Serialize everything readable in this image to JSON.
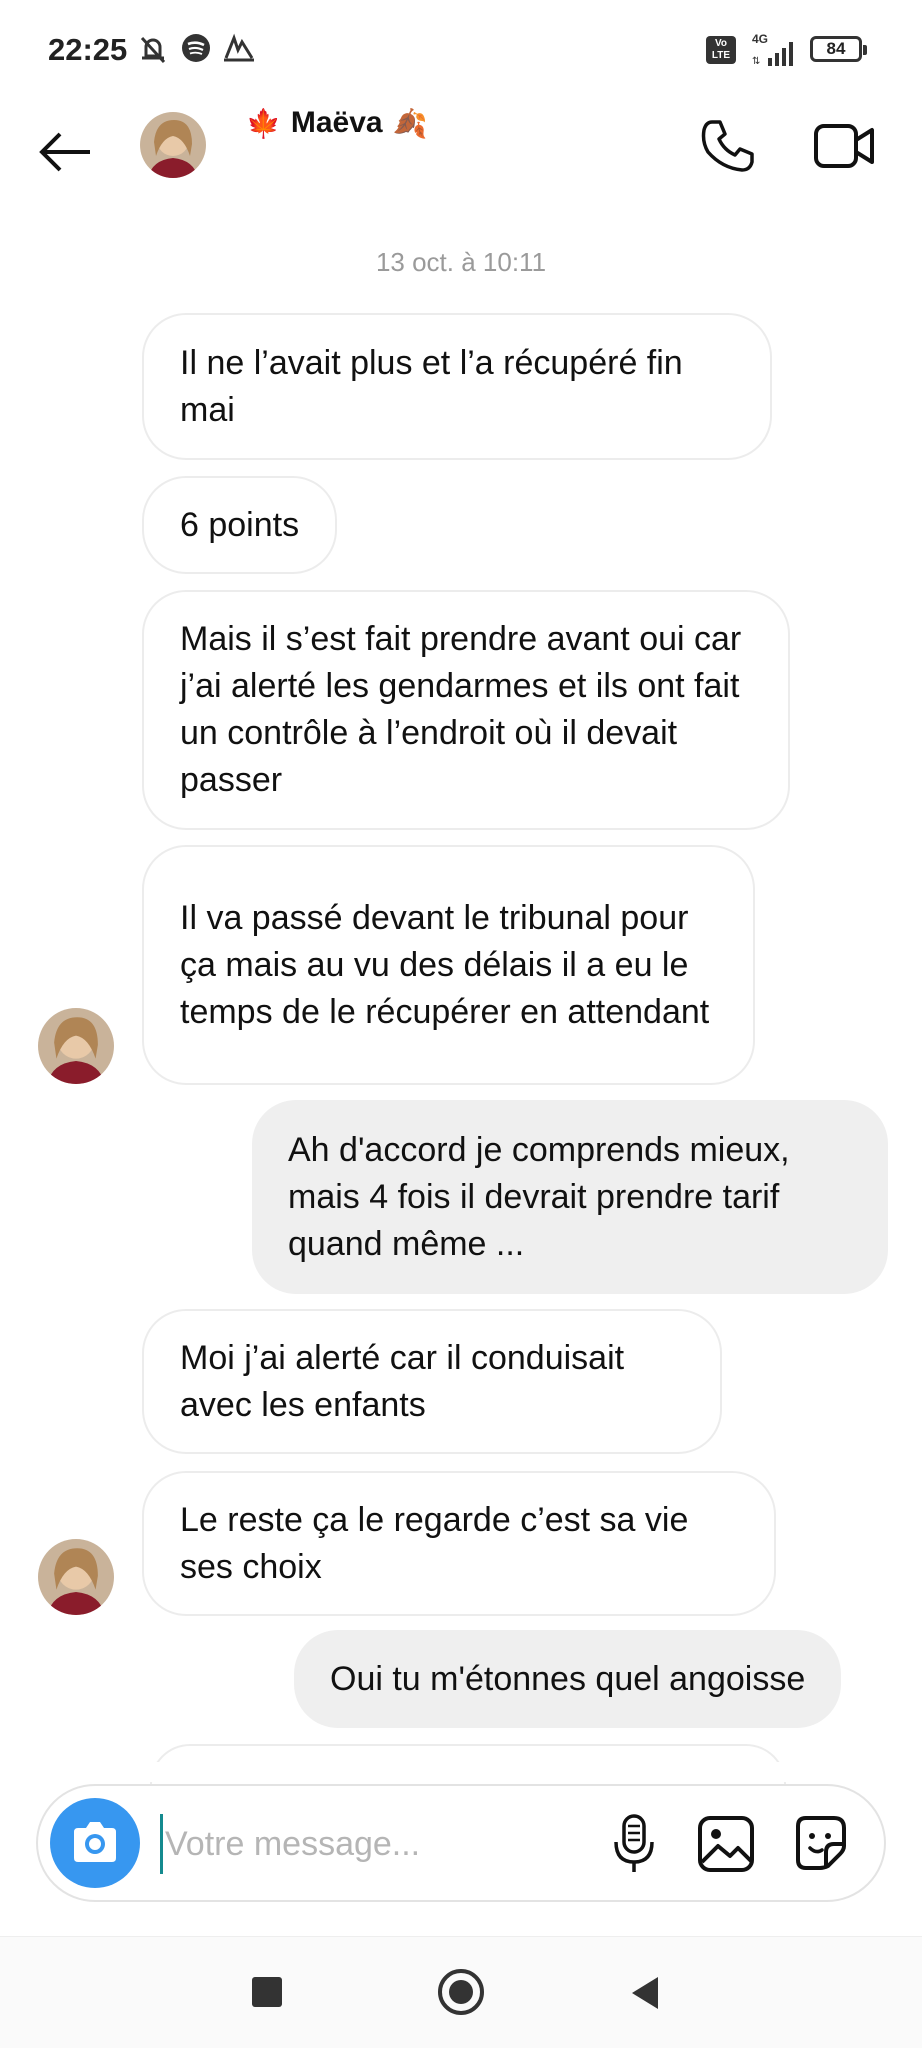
{
  "status_bar": {
    "time": "22:25",
    "battery": "84",
    "network": "4G",
    "volte": "Vo LTE"
  },
  "header": {
    "contact_name": "Maëva",
    "emoji_left": "🍁",
    "emoji_right": "🍂"
  },
  "chat": {
    "timestamp": "13 oct. à 10:11",
    "messages": [
      {
        "dir": "in",
        "text": "Il ne l’avait plus et l’a récupéré fin mai"
      },
      {
        "dir": "in",
        "text": "6 points"
      },
      {
        "dir": "in",
        "text": "Mais il s’est fait prendre avant oui car j’ai alerté les gendarmes et ils ont fait un contrôle à l’endroit où il devait passer"
      },
      {
        "dir": "in",
        "text": "Il va passé devant le tribunal pour ça mais au vu des délais il a eu le temps de le récupérer en attendant"
      },
      {
        "dir": "out",
        "text": "Ah d'accord je comprends mieux, mais 4 fois il devrait prendre tarif quand même ..."
      },
      {
        "dir": "in",
        "text": "Moi j’ai alerté car il conduisait avec les enfants"
      },
      {
        "dir": "in",
        "text": "Le reste ça le regarde c’est sa vie ses choix"
      },
      {
        "dir": "out",
        "text": "Oui tu m'étonnes quel angoisse"
      }
    ]
  },
  "composer": {
    "placeholder": "Votre message..."
  },
  "colors": {
    "accent": "#3797f0",
    "outgoing_bubble": "#efefef",
    "incoming_border": "#ececec"
  },
  "icons": [
    "back-arrow-icon",
    "phone-icon",
    "video-camera-icon",
    "camera-icon",
    "microphone-icon",
    "gallery-icon",
    "sticker-icon",
    "mute-icon",
    "spotify-icon"
  ]
}
